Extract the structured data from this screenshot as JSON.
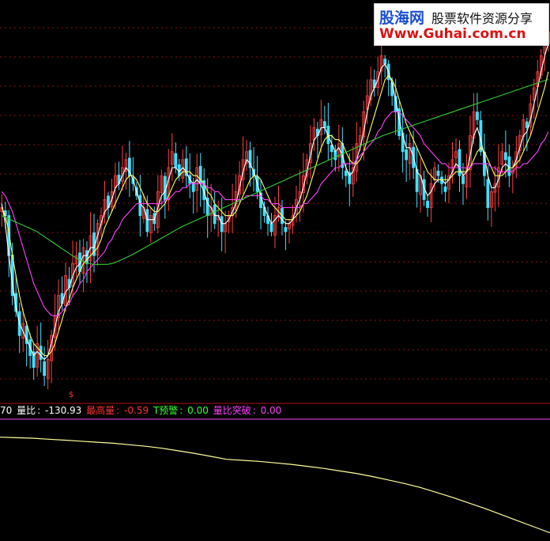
{
  "indicator": {
    "prefix": "70",
    "liangbi_label": "量比",
    "liangbi_value": "-130.93",
    "zuigao_label": "最高量",
    "zuigao_value": "-0.59",
    "tyujing_label": "T预警",
    "tyujing_value": "0.00",
    "tupo_label": "量比突破",
    "tupo_value": "0.00",
    "colors": {
      "liangbi": "#ffffff",
      "zuigao": "#ff3030",
      "tyujing": "#33ff33",
      "tupo": "#ff40ff"
    }
  },
  "signal_marker": "$",
  "watermark": {
    "brand": "股海网",
    "tagline": "股票软件资源分享",
    "url": "Www.Guhai.com.cn"
  },
  "chart_data": [
    {
      "type": "candlestick",
      "panel": "price",
      "grid": true,
      "grid_style": "dashed-red-horizontal",
      "note": "unlabeled axes; values in relative units 0-100",
      "candles_close": [
        62,
        60,
        50,
        40,
        36,
        30,
        33,
        28,
        25,
        22,
        28,
        24,
        20,
        24,
        30,
        35,
        40,
        38,
        45,
        42,
        48,
        50,
        46,
        52,
        48,
        55,
        50,
        58,
        60,
        64,
        62,
        66,
        70,
        68,
        72,
        74,
        70,
        68,
        65,
        60,
        62,
        56,
        60,
        58,
        66,
        70,
        64,
        72,
        76,
        72,
        70,
        74,
        70,
        68,
        66,
        72,
        68,
        64,
        60,
        62,
        58,
        60,
        56,
        58,
        60,
        62,
        66,
        70,
        74,
        76,
        72,
        70,
        66,
        62,
        60,
        58,
        56,
        60,
        62,
        58,
        56,
        58,
        60,
        64,
        66,
        70,
        74,
        78,
        82,
        80,
        84,
        82,
        78,
        76,
        74,
        78,
        72,
        70,
        68,
        72,
        78,
        80,
        86,
        90,
        94,
        92,
        96,
        100,
        98,
        94,
        90,
        86,
        80,
        76,
        74,
        78,
        72,
        66,
        70,
        64,
        62,
        68,
        72,
        70,
        68,
        66,
        70,
        74,
        76,
        70,
        68,
        72,
        80,
        86,
        84,
        76,
        70,
        62,
        66,
        68,
        72,
        76,
        74,
        70,
        72,
        76,
        80,
        84,
        82,
        88,
        92,
        96,
        100,
        104,
        106
      ],
      "ma_lines": [
        {
          "color": "#ffffff",
          "values": [
            63,
            58,
            50,
            43,
            37,
            33,
            31,
            29,
            27,
            25,
            26,
            25,
            24,
            25,
            28,
            32,
            36,
            38,
            41,
            42,
            45,
            47,
            48,
            50,
            50,
            52,
            52,
            55,
            58,
            61,
            62,
            64,
            67,
            68,
            70,
            72,
            71,
            69,
            66,
            63,
            62,
            59,
            59,
            59,
            62,
            65,
            66,
            69,
            72,
            72,
            71,
            72,
            71,
            69,
            68,
            69,
            68,
            66,
            63,
            62,
            60,
            60,
            58,
            58,
            59,
            61,
            63,
            67,
            71,
            74,
            73,
            71,
            68,
            65,
            62,
            60,
            58,
            59,
            60,
            59,
            58,
            58,
            59,
            62,
            64,
            67,
            71,
            75,
            79,
            80,
            82,
            82,
            80,
            78,
            76,
            77,
            75,
            72,
            70,
            71,
            74,
            77,
            81,
            86,
            90,
            92,
            94,
            97,
            98,
            96,
            93,
            89,
            84,
            80,
            77,
            77,
            75,
            71,
            70,
            67,
            65,
            66,
            68,
            69,
            69,
            68,
            69,
            71,
            73,
            72,
            70,
            71,
            75,
            80,
            82,
            79,
            75,
            70,
            67,
            67,
            69,
            72,
            73,
            72,
            72,
            74,
            77,
            80,
            81,
            84,
            88,
            92,
            96,
            100,
            103
          ]
        },
        {
          "color": "#ffff66",
          "values": [
            62,
            60,
            56,
            50,
            45,
            40,
            36,
            33,
            30,
            28,
            27,
            26,
            25,
            25,
            26,
            28,
            31,
            34,
            37,
            39,
            42,
            44,
            46,
            48,
            49,
            50,
            51,
            52,
            54,
            57,
            59,
            61,
            63,
            65,
            67,
            69,
            70,
            70,
            69,
            67,
            65,
            63,
            62,
            61,
            61,
            62,
            63,
            65,
            67,
            69,
            70,
            71,
            71,
            71,
            70,
            70,
            69,
            68,
            66,
            65,
            63,
            62,
            61,
            60,
            60,
            60,
            61,
            63,
            65,
            67,
            69,
            70,
            70,
            69,
            67,
            65,
            63,
            62,
            61,
            60,
            59,
            59,
            59,
            60,
            61,
            63,
            65,
            68,
            71,
            74,
            77,
            79,
            80,
            80,
            79,
            79,
            78,
            76,
            74,
            73,
            73,
            74,
            76,
            79,
            82,
            85,
            88,
            91,
            94,
            95,
            94,
            92,
            89,
            86,
            83,
            81,
            79,
            77,
            75,
            73,
            71,
            70,
            69,
            69,
            69,
            69,
            69,
            70,
            71,
            71,
            71,
            71,
            72,
            74,
            76,
            77,
            76,
            74,
            72,
            70,
            70,
            70,
            71,
            72,
            72,
            73,
            74,
            76,
            78,
            80,
            83,
            86,
            89,
            92,
            96
          ]
        },
        {
          "color": "#ff40ff",
          "values": [
            66,
            65,
            63,
            61,
            58,
            55,
            52,
            49,
            46,
            43,
            41,
            39,
            37,
            36,
            35,
            35,
            35,
            36,
            37,
            38,
            40,
            41,
            43,
            44,
            46,
            47,
            48,
            49,
            50,
            51,
            53,
            54,
            56,
            57,
            59,
            60,
            61,
            62,
            63,
            63,
            63,
            63,
            63,
            63,
            63,
            63,
            64,
            64,
            65,
            66,
            66,
            67,
            67,
            68,
            68,
            68,
            68,
            68,
            67,
            67,
            66,
            66,
            65,
            64,
            64,
            64,
            64,
            64,
            64,
            65,
            65,
            65,
            65,
            65,
            64,
            64,
            63,
            63,
            63,
            62,
            62,
            62,
            62,
            62,
            62,
            63,
            63,
            64,
            65,
            66,
            68,
            69,
            70,
            71,
            72,
            72,
            73,
            73,
            73,
            73,
            74,
            75,
            76,
            77,
            78,
            79,
            81,
            82,
            84,
            85,
            86,
            86,
            86,
            85,
            84,
            83,
            82,
            81,
            80,
            78,
            77,
            76,
            75,
            74,
            73,
            73,
            72,
            72,
            72,
            72,
            72,
            72,
            72,
            73,
            73,
            73,
            73,
            73,
            72,
            72,
            71,
            71,
            71,
            71,
            71,
            72,
            72,
            73,
            73,
            74,
            75,
            76,
            78,
            79,
            81
          ]
        },
        {
          "color": "#33cc33",
          "values": [
            60,
            59.6,
            59.2,
            58.8,
            58.4,
            58,
            57.6,
            57.2,
            56.8,
            56.4,
            56,
            55.4,
            54.8,
            54.2,
            53.6,
            53,
            52.4,
            51.8,
            51.2,
            50.6,
            50,
            49.5,
            49,
            48.6,
            48.2,
            48,
            47.8,
            47.8,
            47.8,
            47.8,
            47.8,
            48,
            48.2,
            48.6,
            49,
            49.4,
            49.8,
            50.2,
            50.7,
            51.2,
            51.7,
            52.2,
            52.7,
            53.2,
            53.7,
            54.2,
            54.7,
            55.2,
            55.7,
            56.2,
            56.7,
            57.2,
            57.6,
            58,
            58.4,
            58.8,
            59.2,
            59.6,
            60,
            60.4,
            60.8,
            61.2,
            61.6,
            62,
            62.4,
            62.8,
            63.2,
            63.6,
            64,
            64.4,
            64.8,
            65.2,
            65.6,
            66,
            66.4,
            66.8,
            67.2,
            67.6,
            68,
            68.4,
            68.8,
            69.2,
            69.6,
            70,
            70.4,
            70.8,
            71.2,
            71.6,
            72,
            72.4,
            72.8,
            73.2,
            73.6,
            74,
            74.4,
            74.8,
            75.2,
            75.6,
            76,
            76.4,
            76.8,
            77.2,
            77.6,
            78,
            78.4,
            78.8,
            79.2,
            79.6,
            80,
            80.3,
            80.6,
            80.9,
            81.2,
            81.5,
            81.8,
            82.1,
            82.4,
            82.7,
            83,
            83.3,
            83.6,
            83.9,
            84.2,
            84.5,
            84.8,
            85.1,
            85.4,
            85.7,
            86,
            86.3,
            86.6,
            86.9,
            87.2,
            87.5,
            87.8,
            88.1,
            88.4,
            88.7,
            89,
            89.3,
            89.6,
            89.9,
            90.2,
            90.5,
            90.8,
            91.1,
            91.4,
            91.7,
            92,
            92.3,
            92.6,
            92.9,
            93.2,
            93.5,
            93.8,
            94.1
          ]
        }
      ]
    },
    {
      "type": "line",
      "panel": "indicator",
      "grid": false,
      "series": [
        {
          "color": "#ffff99",
          "values": [
            20,
            19.9,
            19.8,
            19.6,
            19.4,
            19.2,
            19,
            18.8,
            18.5,
            18.2,
            17.8,
            17.3,
            16.8,
            16.2,
            15.6,
            15.4,
            15.2,
            14.9,
            14.6,
            14.2,
            13.8,
            13.3,
            12.8,
            12.2,
            11.5,
            10.8,
            10,
            9,
            8,
            6.9,
            5.8,
            4.6,
            3.4,
            2.2,
            1
          ]
        }
      ]
    }
  ]
}
